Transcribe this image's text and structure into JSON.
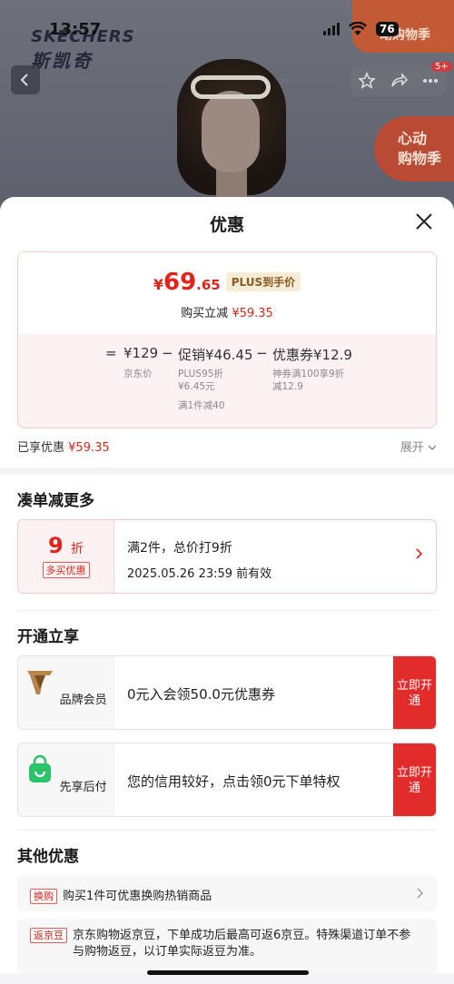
{
  "status_bar": {
    "time": "13:57",
    "battery": "76"
  },
  "background": {
    "brand_en": "SKECHERS",
    "brand_cn": "斯凯奇",
    "promo_top": "动购物季",
    "promo_side_line1": "心动",
    "promo_side_line2": "购物季",
    "share_badge": "5+"
  },
  "sheet": {
    "title": "优惠",
    "price": {
      "symbol": "¥",
      "integer": "69",
      "decimal": ".65",
      "tag": "PLUS到手价"
    },
    "instant_label": "购买立减",
    "instant_amount": "¥59.35",
    "calc": {
      "eq": "=",
      "base": "¥129",
      "base_label": "京东价",
      "minus1": "−",
      "promo": "促销¥46.45",
      "promo_sub1": "PLUS95折",
      "promo_sub2": "¥6.45元",
      "promo_sub3": "满1件减40",
      "minus2": "−",
      "coupon": "优惠券¥12.9",
      "coupon_sub1": "神券满100享9折",
      "coupon_sub2": "减12.9"
    },
    "enjoyed_label": "已享优惠",
    "enjoyed_amount": "¥59.35",
    "expand_label": "展开"
  },
  "bundle": {
    "title": "凑单减更多",
    "discount_num": "9",
    "discount_unit": "折",
    "discount_tag": "多买优惠",
    "desc": "满2件，总价打9折",
    "valid": "2025.05.26 23:59 前有效"
  },
  "membership": {
    "title": "开通立享",
    "items": [
      {
        "label": "品牌会员",
        "desc": "0元入会领50.0元优惠券",
        "button": "立即开通"
      },
      {
        "label": "先享后付",
        "desc": "您的信用较好，点击领0元下单特权",
        "button": "立即开通"
      }
    ]
  },
  "other": {
    "title": "其他优惠",
    "items": [
      {
        "tag": "换购",
        "text": "购买1件可优惠换购热销商品"
      },
      {
        "tag": "返京豆",
        "text": "京东购物返京豆，下单成功后最高可返6京豆。特殊渠道订单不参与购物返豆，以订单实际返豆为准。"
      }
    ]
  },
  "colors": {
    "accent_red": "#e2231a",
    "member_gold": "#8a5a1f",
    "pay_green": "#2bc46b"
  }
}
